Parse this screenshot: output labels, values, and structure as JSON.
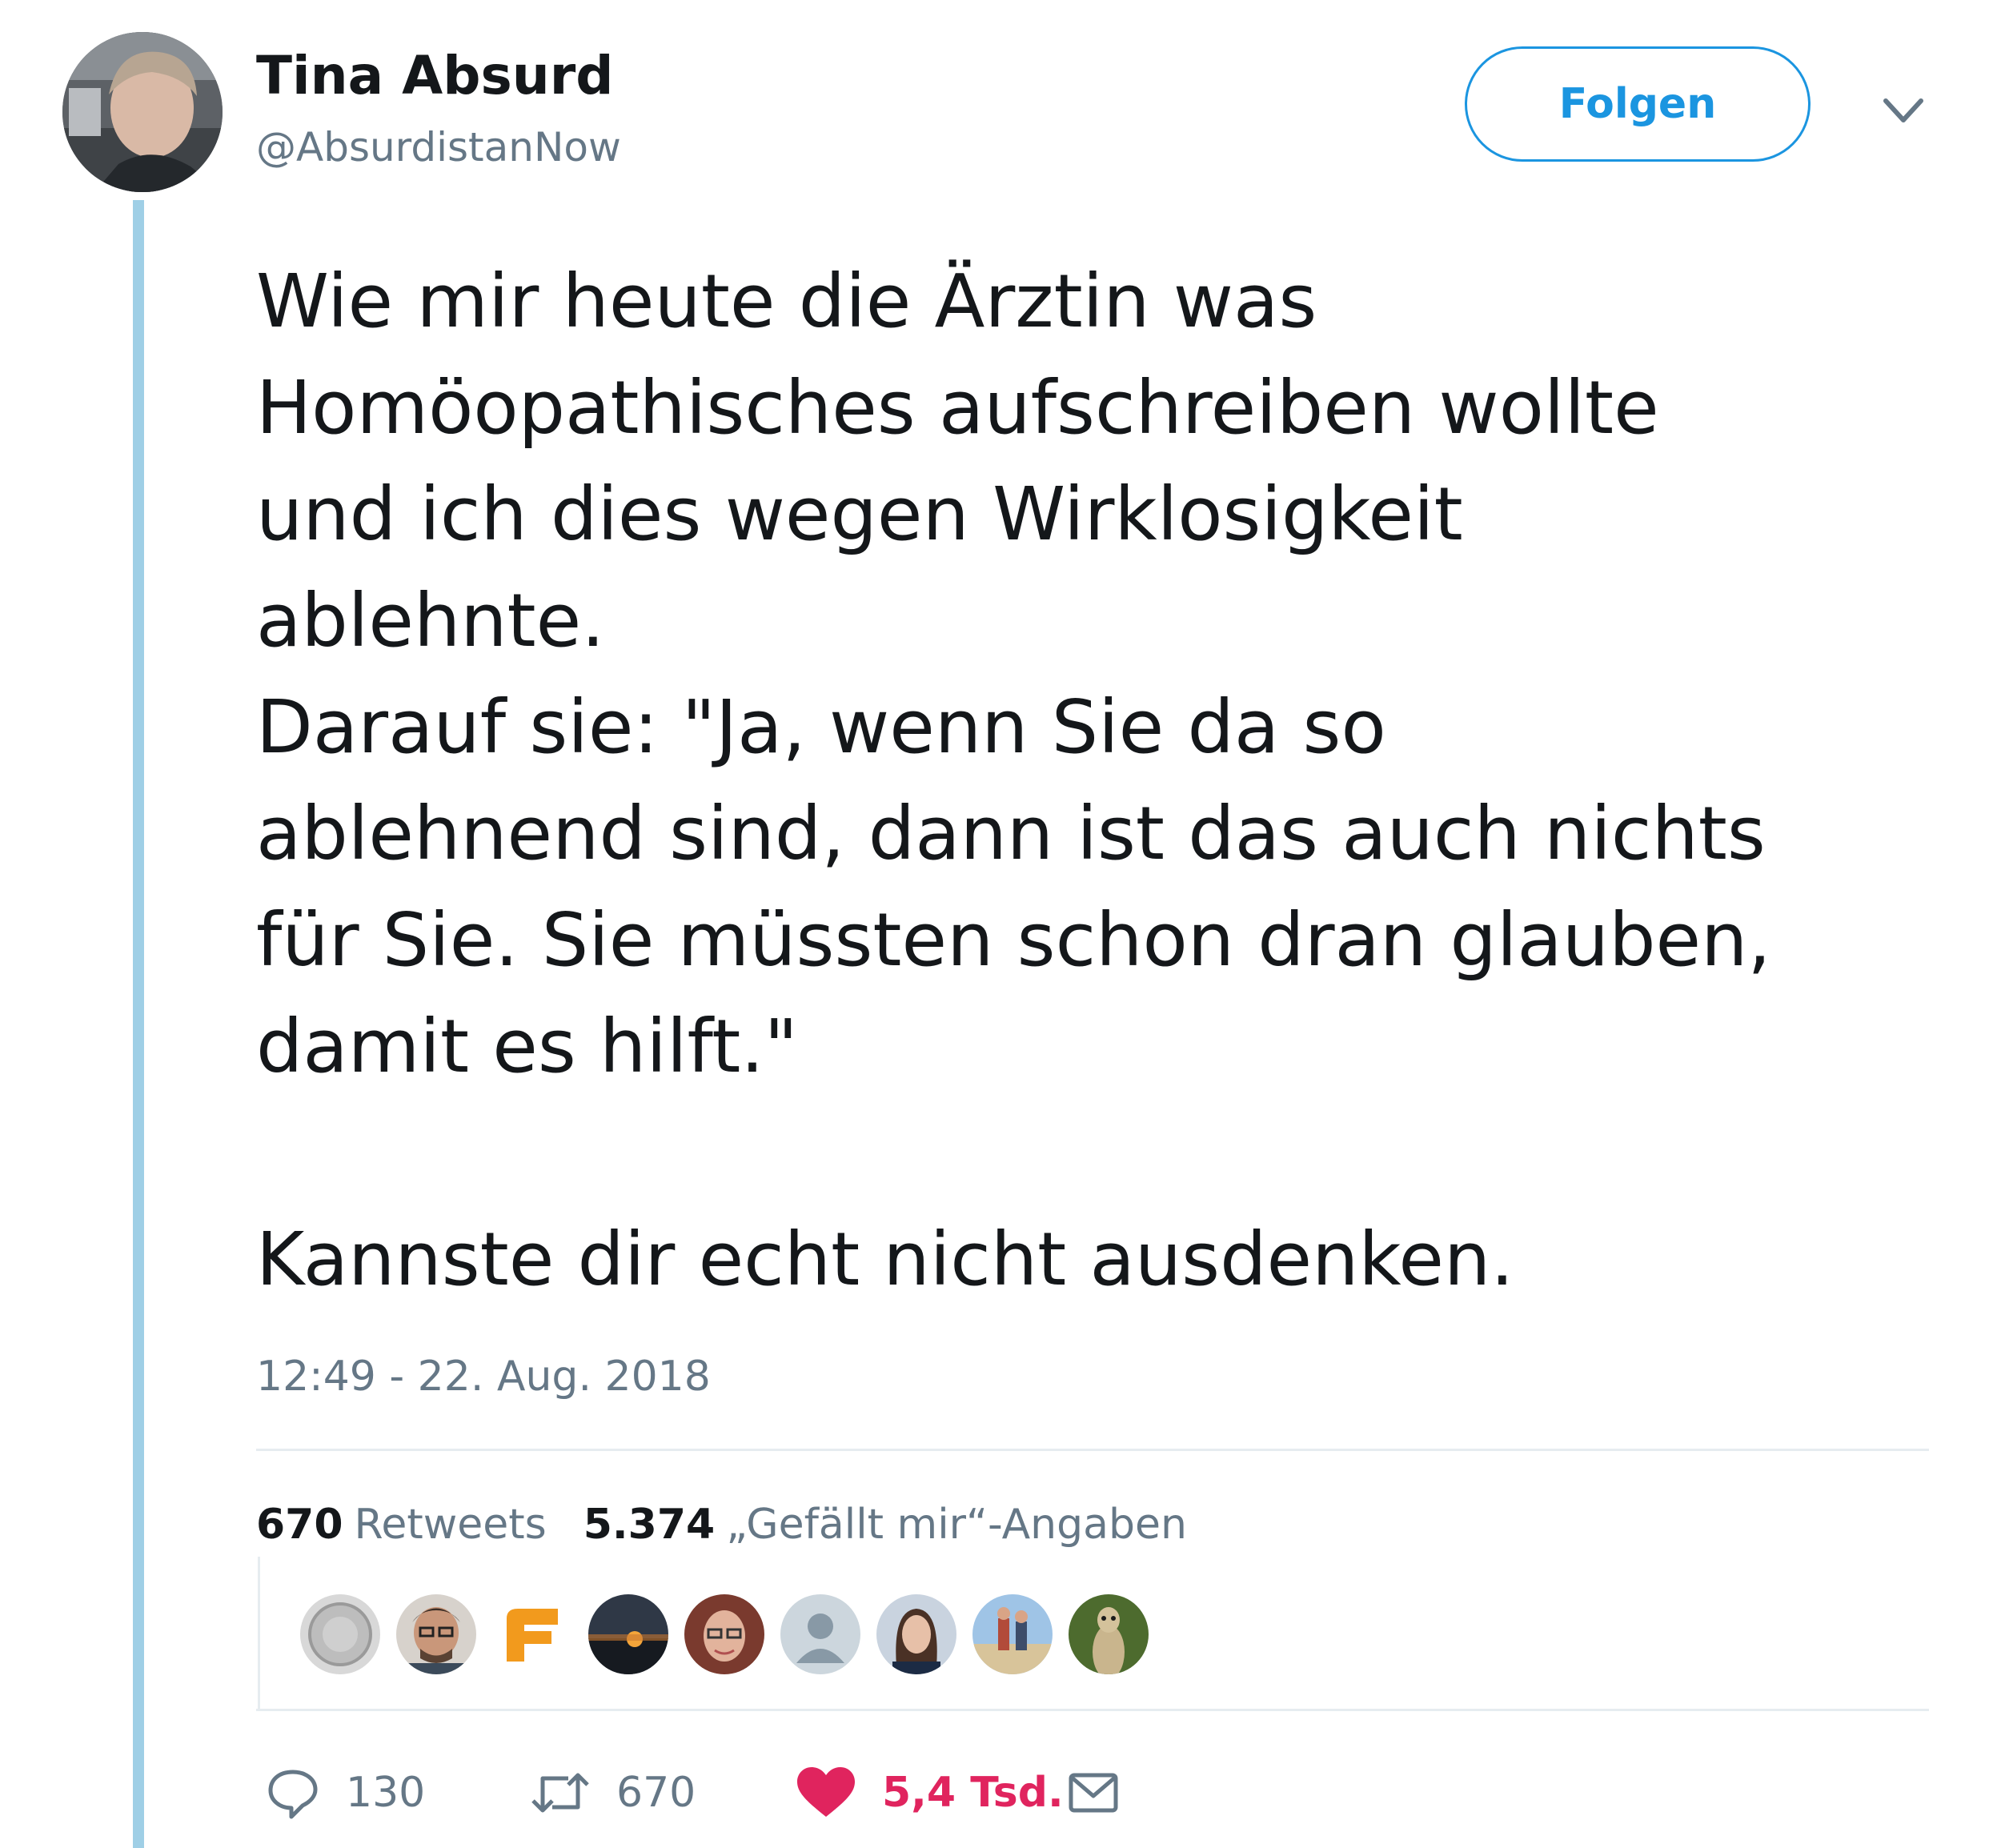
{
  "author": {
    "name": "Tina Absurd",
    "handle": "@AbsurdistanNow",
    "avatar_icon": "profile-photo"
  },
  "header": {
    "follow_label": "Folgen",
    "menu_icon": "chevron-down-icon"
  },
  "tweet": {
    "text": "Wie mir heute die Ärztin was\nHomöopathisches aufschreiben wollte\nund ich dies wegen Wirklosigkeit\nablehnte.\nDarauf sie: \"Ja, wenn Sie da so\nablehnend sind, dann ist das auch nichts\nfür Sie. Sie müssten schon dran glauben,\ndamit es hilft.\"\n\nKannste dir echt nicht ausdenken.",
    "timestamp": "12:49 - 22. Aug. 2018"
  },
  "stats": {
    "retweets_count": "670",
    "retweets_label": "Retweets",
    "likes_count": "5.374",
    "likes_label": "„Gefällt mir“-Angaben"
  },
  "likers": [
    {
      "name": "liker-avatar-1",
      "icon": "coin-photo"
    },
    {
      "name": "liker-avatar-2",
      "icon": "man-with-glasses-photo"
    },
    {
      "name": "liker-avatar-3",
      "icon": "orange-logo"
    },
    {
      "name": "liker-avatar-4",
      "icon": "sunset-photo"
    },
    {
      "name": "liker-avatar-5",
      "icon": "woman-with-glasses-photo"
    },
    {
      "name": "liker-avatar-6",
      "icon": "default-profile-icon"
    },
    {
      "name": "liker-avatar-7",
      "icon": "woman-photo"
    },
    {
      "name": "liker-avatar-8",
      "icon": "beach-people-photo"
    },
    {
      "name": "liker-avatar-9",
      "icon": "meerkat-photo"
    }
  ],
  "actions": {
    "reply_count": "130",
    "retweet_count": "670",
    "like_count": "5,4 Tsd.",
    "colors": {
      "muted": "#657786",
      "like": "#e0245e",
      "accent": "#1b95e0",
      "thread_line": "#9fcfe6"
    }
  }
}
